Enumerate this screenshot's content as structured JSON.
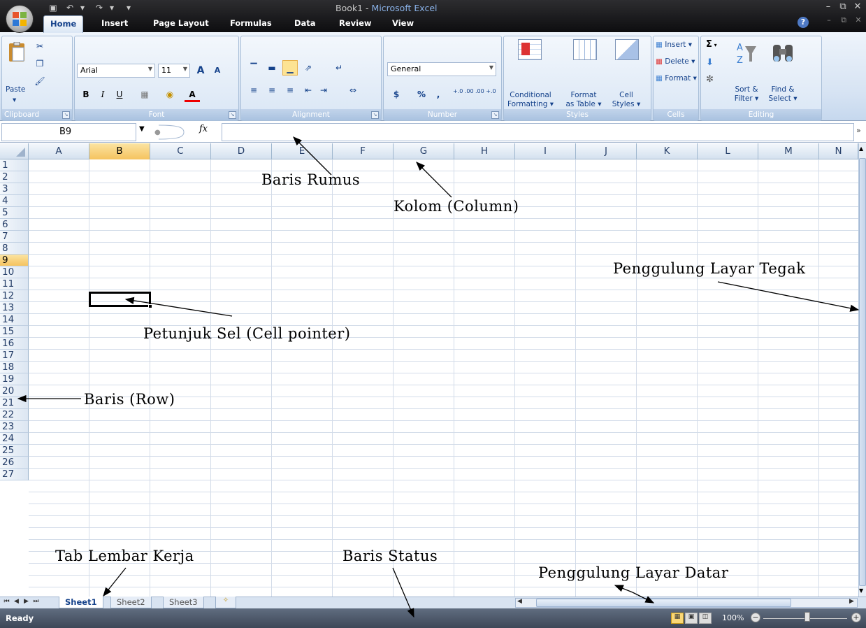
{
  "title": {
    "prefix": "Book1 - ",
    "app": "Microsoft Excel"
  },
  "tabs": [
    "Home",
    "Insert",
    "Page Layout",
    "Formulas",
    "Data",
    "Review",
    "View"
  ],
  "ribbon": {
    "clipboard": {
      "label": "Clipboard",
      "paste": "Paste"
    },
    "font": {
      "label": "Font",
      "name": "Arial",
      "size": "11",
      "grow": "A",
      "shrink": "A",
      "bold": "B",
      "italic": "I",
      "underline": "U",
      "font_color": "A"
    },
    "alignment": {
      "label": "Alignment"
    },
    "number": {
      "label": "Number",
      "format": "General",
      "currency": "$",
      "percent": "%",
      "comma": ",",
      "inc_decimal": "+.0 .00",
      "dec_decimal": ".00 +.0"
    },
    "styles": {
      "label": "Styles",
      "conditional": [
        "Conditional",
        "Formatting ▾"
      ],
      "format_table": [
        "Format",
        "as Table ▾"
      ],
      "cell_styles": [
        "Cell",
        "Styles ▾"
      ]
    },
    "cells": {
      "label": "Cells",
      "insert": "Insert ▾",
      "delete": "Delete ▾",
      "format": "Format ▾"
    },
    "editing": {
      "label": "Editing",
      "sort_filter": [
        "Sort &",
        "Filter ▾"
      ],
      "find_select": [
        "Find &",
        "Select ▾"
      ],
      "sum": "Σ"
    }
  },
  "formula_bar": {
    "name_box": "B9",
    "fx": "fx",
    "value": ""
  },
  "columns": [
    "A",
    "B",
    "C",
    "D",
    "E",
    "F",
    "G",
    "H",
    "I",
    "J",
    "K",
    "L",
    "M",
    "N"
  ],
  "selected_column": "B",
  "rows": [
    "1",
    "2",
    "3",
    "4",
    "5",
    "6",
    "7",
    "8",
    "9",
    "10",
    "11",
    "12",
    "13",
    "14",
    "15",
    "16",
    "17",
    "18",
    "19",
    "20",
    "21",
    "22",
    "23",
    "24",
    "25",
    "26",
    "27"
  ],
  "selected_row": "9",
  "sheets": [
    "Sheet1",
    "Sheet2",
    "Sheet3"
  ],
  "active_sheet": "Sheet1",
  "status": {
    "text": "Ready",
    "zoom": "100%"
  },
  "annotations": {
    "formula_bar": "Baris Rumus",
    "column": "Kolom (Column)",
    "vscroll": "Penggulung Layar Tegak",
    "cell_pointer": "Petunjuk Sel (Cell pointer)",
    "row": "Baris (Row)",
    "sheet_tab": "Tab Lembar Kerja",
    "status_bar": "Baris Status",
    "hscroll": "Penggulung Layar Datar"
  },
  "colors": {
    "accent": "#15428b",
    "selection": "#f5c35f",
    "ribbon": "#d6e3f3",
    "statusbar": "#3d4757"
  }
}
